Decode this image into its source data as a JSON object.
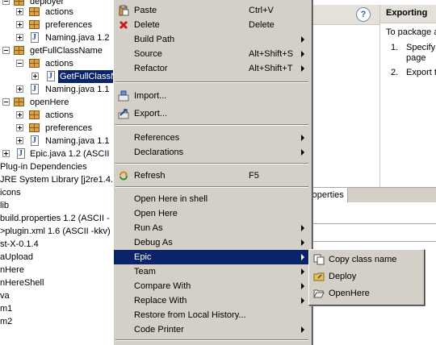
{
  "tree": {
    "items": [
      {
        "label": "deployer"
      },
      {
        "label": "actions"
      },
      {
        "label": "preferences"
      },
      {
        "label": "Naming.java  1.2"
      },
      {
        "label": "getFullClassName"
      },
      {
        "label": "actions"
      },
      {
        "label": "GetFullClassN"
      },
      {
        "label": "Naming.java  1.1"
      },
      {
        "label": "openHere"
      },
      {
        "label": "actions"
      },
      {
        "label": "preferences"
      },
      {
        "label": "Naming.java  1.1"
      },
      {
        "label": "Epic.java  1.2  (ASCII"
      },
      {
        "label": "Plug-in Dependencies"
      },
      {
        "label": "JRE System Library [j2re1.4.2"
      },
      {
        "label": "icons"
      },
      {
        "label": "lib"
      },
      {
        "label": "build.properties  1.2  (ASCII -"
      },
      {
        "label": ">plugin.xml  1.6  (ASCII -kkv)"
      },
      {
        "label": "st-X-0.1.4"
      },
      {
        "label": "aUpload"
      },
      {
        "label": "nHere"
      },
      {
        "label": "nHereShell"
      },
      {
        "label": "va"
      },
      {
        "label": "m1"
      },
      {
        "label": "m2"
      }
    ]
  },
  "cheatsheet": {
    "title": "Exporting",
    "intro": "To package a",
    "steps": [
      {
        "num": "1.",
        "text": "Specify",
        "text2": "page"
      },
      {
        "num": "2.",
        "text": "Export t"
      }
    ],
    "help_icon": "?"
  },
  "bottom_tab": {
    "label": "roperties"
  },
  "context_menu": {
    "paste": {
      "label": "Paste",
      "accel": "Ctrl+V"
    },
    "delete": {
      "label": "Delete",
      "accel": "Delete"
    },
    "build_path": {
      "label": "Build Path"
    },
    "source": {
      "label": "Source",
      "accel": "Alt+Shift+S"
    },
    "refactor": {
      "label": "Refactor",
      "accel": "Alt+Shift+T"
    },
    "import": {
      "label": "Import..."
    },
    "export": {
      "label": "Export..."
    },
    "references": {
      "label": "References"
    },
    "declarations": {
      "label": "Declarations"
    },
    "refresh": {
      "label": "Refresh",
      "accel": "F5"
    },
    "open_here_shell": {
      "label": "Open Here in shell"
    },
    "open_here": {
      "label": "Open Here"
    },
    "run_as": {
      "label": "Run As"
    },
    "debug_as": {
      "label": "Debug As"
    },
    "epic": {
      "label": "Epic"
    },
    "team": {
      "label": "Team"
    },
    "compare_with": {
      "label": "Compare With"
    },
    "replace_with": {
      "label": "Replace With"
    },
    "restore_history": {
      "label": "Restore from Local History..."
    },
    "code_printer": {
      "label": "Code Printer"
    }
  },
  "submenu": {
    "copy_class_name": {
      "label": "Copy class name"
    },
    "deploy": {
      "label": "Deploy"
    },
    "open_here": {
      "label": "OpenHere"
    }
  },
  "colors": {
    "selection": "#0a246a",
    "menu_bg": "#d4d0c8"
  }
}
